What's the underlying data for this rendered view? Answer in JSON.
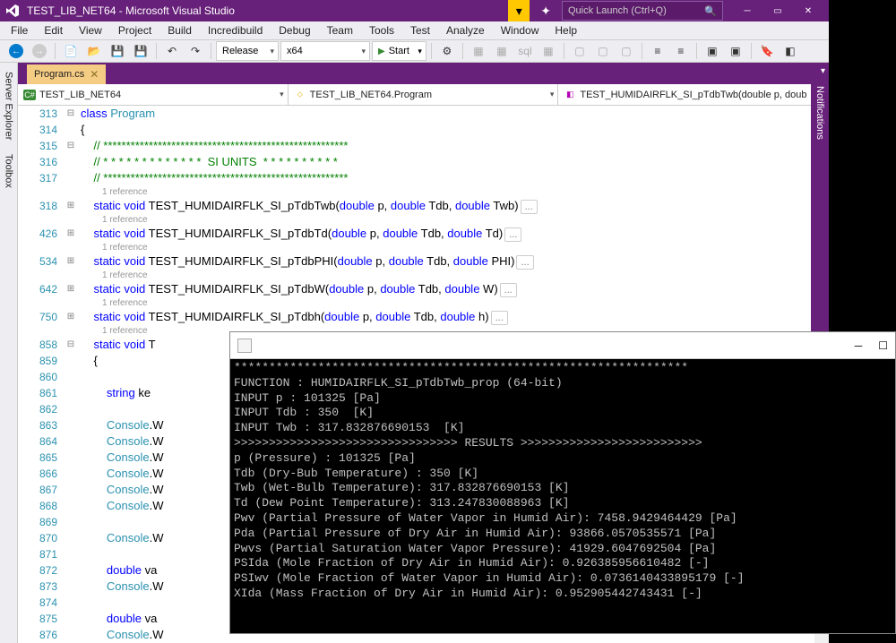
{
  "title": "TEST_LIB_NET64 - Microsoft Visual Studio",
  "quick_launch_placeholder": "Quick Launch (Ctrl+Q)",
  "menu": [
    "File",
    "Edit",
    "View",
    "Project",
    "Build",
    "Incredibuild",
    "Debug",
    "Team",
    "Tools",
    "Test",
    "Analyze",
    "Window",
    "Help"
  ],
  "toolbar": {
    "config": "Release",
    "platform": "x64",
    "start": "Start"
  },
  "side_tabs": [
    "Server Explorer",
    "Toolbox"
  ],
  "right_tabs": [
    "Notifications"
  ],
  "doc_tab": {
    "name": "Program.cs"
  },
  "nav": {
    "project": "TEST_LIB_NET64",
    "namespace": "TEST_LIB_NET64.Program",
    "member": "TEST_HUMIDAIRFLK_SI_pTdbTwb(double p, doub"
  },
  "refs_label": "1 reference",
  "code": {
    "l313": "class Program",
    "l314": "{",
    "l315": "// ******************************************************",
    "l316": "// * * * * * * * * * * * * *  SI UNITS  * * * * * * * * * *",
    "l317": "// ******************************************************",
    "l318": {
      "pre": "static void ",
      "name": "TEST_HUMIDAIRFLK_SI_pTdbTwb",
      "sig": "(double p, double Tdb, double Twb)"
    },
    "l426": {
      "pre": "static void ",
      "name": "TEST_HUMIDAIRFLK_SI_pTdbTd",
      "sig": "(double p, double Tdb, double Td)"
    },
    "l534": {
      "pre": "static void ",
      "name": "TEST_HUMIDAIRFLK_SI_pTdbPHI",
      "sig": "(double p, double Tdb, double PHI)"
    },
    "l642": {
      "pre": "static void ",
      "name": "TEST_HUMIDAIRFLK_SI_pTdbW",
      "sig": "(double p, double Tdb, double W)"
    },
    "l750": {
      "pre": "static void ",
      "name": "TEST_HUMIDAIRFLK_SI_pTdbh",
      "sig": "(double p, double Tdb, double h)"
    },
    "l858": "static void T",
    "l859": "{",
    "l861": "string ke",
    "cw": "Console.W",
    "dv": "double va"
  },
  "line_numbers": [
    "313",
    "314",
    "315",
    "316",
    "317",
    "",
    "318",
    "",
    "426",
    "",
    "534",
    "",
    "642",
    "",
    "750",
    "",
    "858",
    "859",
    "860",
    "861",
    "862",
    "863",
    "864",
    "865",
    "866",
    "867",
    "868",
    "869",
    "870",
    "871",
    "872",
    "873",
    "874",
    "875",
    "876"
  ],
  "console": [
    "*****************************************************************",
    "FUNCTION : HUMIDAIRFLK_SI_pTdbTwb_prop (64-bit)",
    "INPUT p : 101325 [Pa]",
    "INPUT Tdb : 350  [K]",
    "INPUT Twb : 317.832876690153  [K]",
    ">>>>>>>>>>>>>>>>>>>>>>>>>>>>>>>> RESULTS >>>>>>>>>>>>>>>>>>>>>>>>>>",
    "p (Pressure) : 101325 [Pa]",
    "Tdb (Dry-Bub Temperature) : 350 [K]",
    "Twb (Wet-Bulb Temperature): 317.832876690153 [K]",
    "Td (Dew Point Temperature): 313.247830088963 [K]",
    "Pwv (Partial Pressure of Water Vapor in Humid Air): 7458.9429464429 [Pa]",
    "Pda (Partial Pressure of Dry Air in Humid Air): 93866.0570535571 [Pa]",
    "Pwvs (Partial Saturation Water Vapor Pressure): 41929.6047692504 [Pa]",
    "PSIda (Mole Fraction of Dry Air in Humid Air): 0.926385956610482 [-]",
    "PSIwv (Mole Fraction of Water Vapor in Humid Air): 0.0736140433895179 [-]",
    "XIda (Mass Fraction of Dry Air in Humid Air): 0.952905442743431 [-]"
  ]
}
